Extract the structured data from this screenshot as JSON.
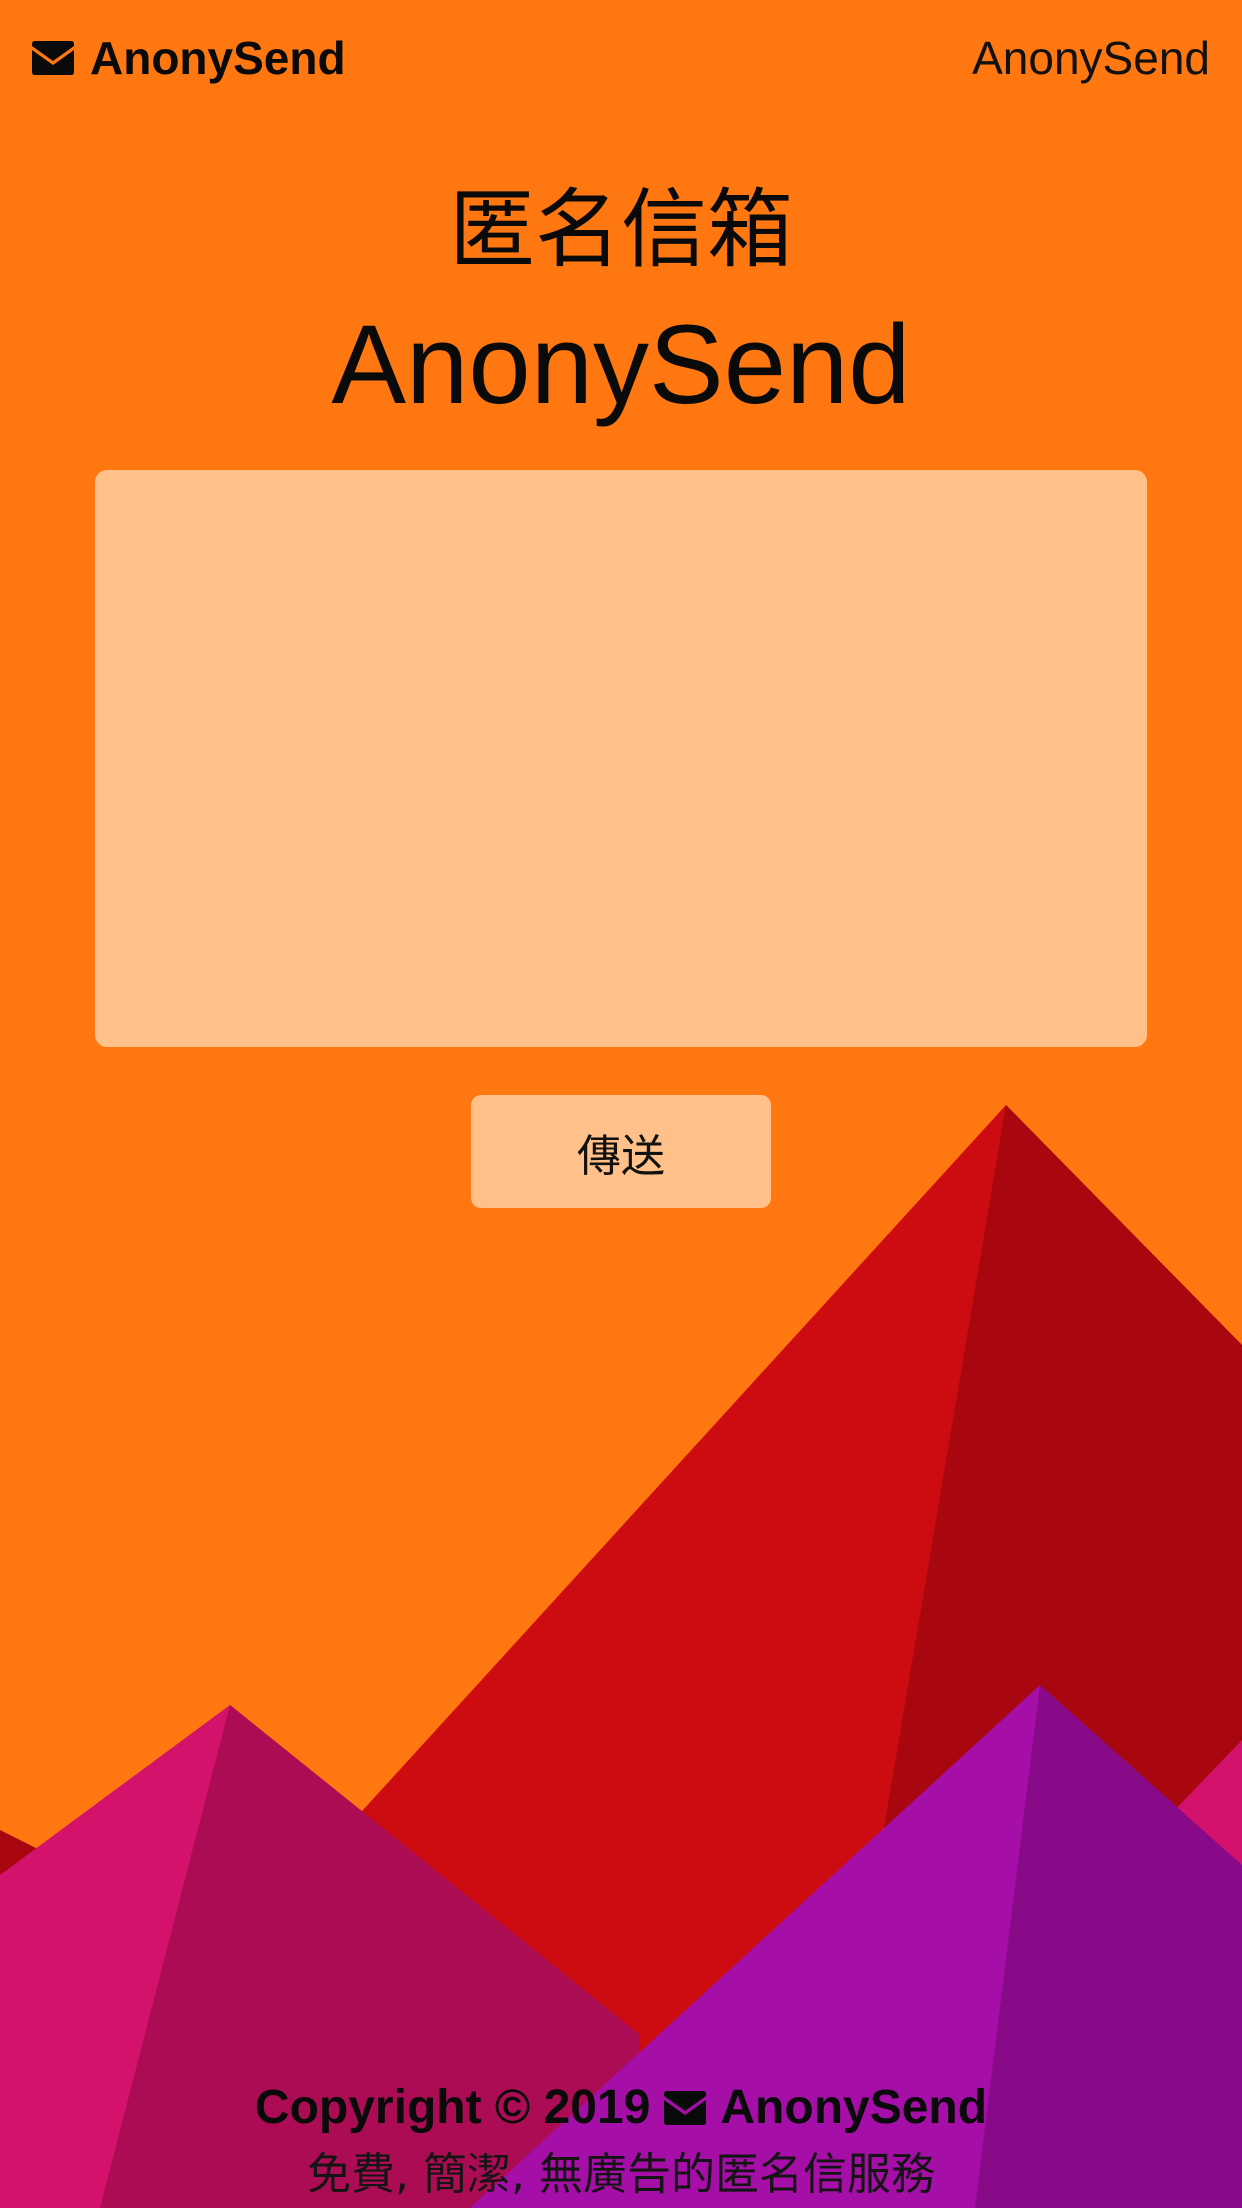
{
  "colors": {
    "background": "#ff7710",
    "input_fill": "#ffc08a",
    "mountain_red": "#cd0c12",
    "mountain_dark_red": "#a80710",
    "mountain_pink": "#d4116b",
    "mountain_magenta": "#ab0c53",
    "mountain_purple": "#a60ea8",
    "mountain_dark_purple": "#880a88"
  },
  "header": {
    "brand_icon": "envelope-icon",
    "brand_label": "AnonySend",
    "right_label": "AnonySend"
  },
  "hero": {
    "title_cn": "匿名信箱",
    "title_en": "AnonySend"
  },
  "form": {
    "message_value": "",
    "message_placeholder": "",
    "send_label": "傳送"
  },
  "footer": {
    "copyright_prefix": "Copyright © 2019",
    "copyright_icon": "envelope-icon",
    "copyright_brand": "AnonySend",
    "tagline": "免費, 簡潔, 無廣告的匿名信服務"
  }
}
